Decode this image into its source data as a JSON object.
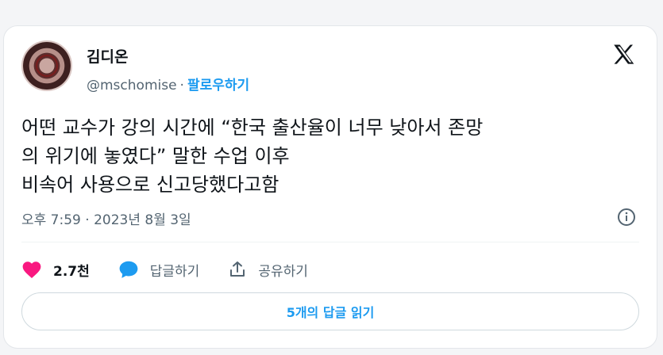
{
  "user": {
    "display_name": "김디온",
    "handle": "@mschomise",
    "separator": "·",
    "follow_label": "팔로우하기"
  },
  "tweet": {
    "lines": [
      "어떤 교수가 강의 시간에 “한국 출산율이 너무 낮아서 존망",
      "의 위기에 놓였다” 말한 수업 이후",
      "비속어 사용으로 신고당했다고함"
    ],
    "timestamp": "오후 7:59 · 2023년 8월 3일"
  },
  "actions": {
    "like_count": "2.7천",
    "reply_label": "답글하기",
    "share_label": "공유하기"
  },
  "replies_button_label": "5개의 답글 읽기",
  "colors": {
    "like": "#f91880",
    "reply": "#1d9bf0",
    "link": "#1d9bf0",
    "text": "#0f1419",
    "muted": "#536471"
  },
  "icons": {
    "brand": "x-logo-icon",
    "info": "info-icon",
    "like": "heart-icon",
    "reply": "speech-bubble-icon",
    "share": "share-icon"
  }
}
